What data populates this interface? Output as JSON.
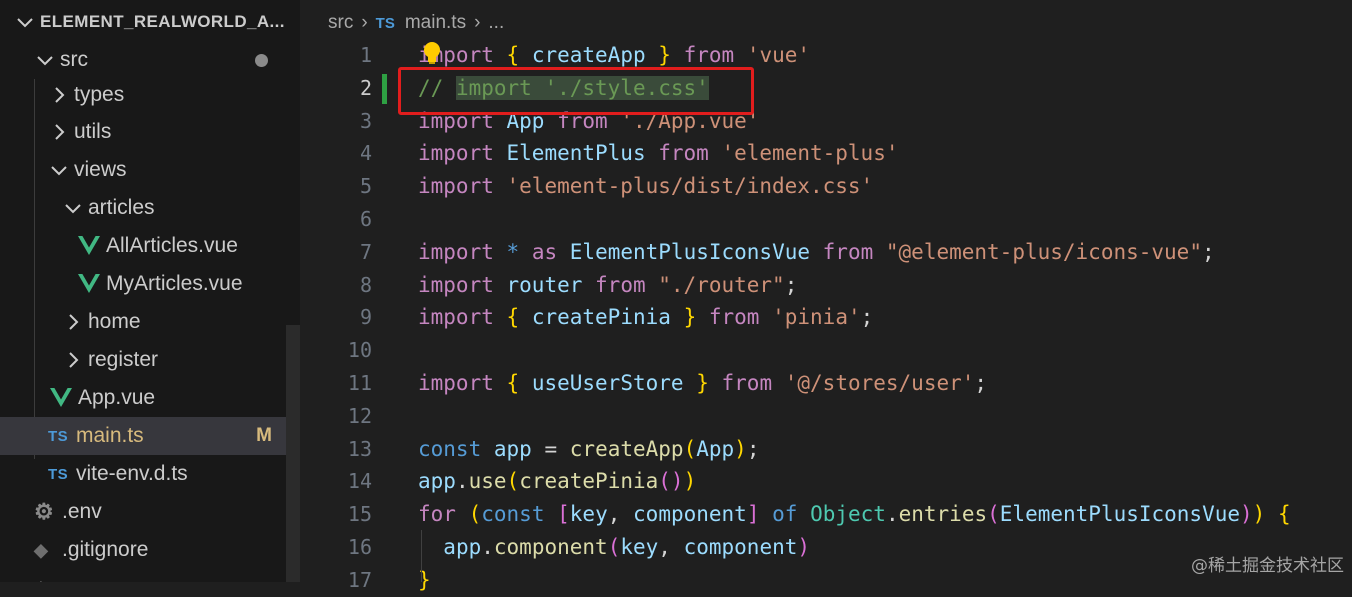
{
  "explorer": {
    "root_label": "ELEMENT_REALWORLD_A...",
    "items": [
      {
        "label": "src",
        "badge": "●"
      },
      {
        "label": "types"
      },
      {
        "label": "utils"
      },
      {
        "label": "views"
      },
      {
        "label": "articles"
      },
      {
        "label": "AllArticles.vue",
        "icon": "vue-icon"
      },
      {
        "label": "MyArticles.vue",
        "icon": "vue-icon"
      },
      {
        "label": "home"
      },
      {
        "label": "register"
      },
      {
        "label": "App.vue",
        "icon": "vue-icon"
      },
      {
        "label": "main.ts",
        "icon_text": "TS",
        "badge": "M",
        "selected": true
      },
      {
        "label": "vite-env.d.ts",
        "icon_text": "TS"
      },
      {
        "label": ".env",
        "icon": "gear-icon"
      },
      {
        "label": ".gitignore",
        "icon": "git-icon"
      }
    ]
  },
  "breadcrumb": {
    "folder": "src",
    "file_icon": "TS",
    "file": "main.ts",
    "more": "..."
  },
  "editor": {
    "line_numbers": [
      "1",
      "2",
      "3",
      "4",
      "5",
      "6",
      "7",
      "8",
      "9",
      "10",
      "11",
      "12",
      "13",
      "14",
      "15",
      "16",
      "17"
    ],
    "active_line": 2
  },
  "colors": {
    "highlight_box": "#e11d1d",
    "modified_gutter": "#2ea043"
  },
  "watermark": "@稀土掘金技术社区"
}
